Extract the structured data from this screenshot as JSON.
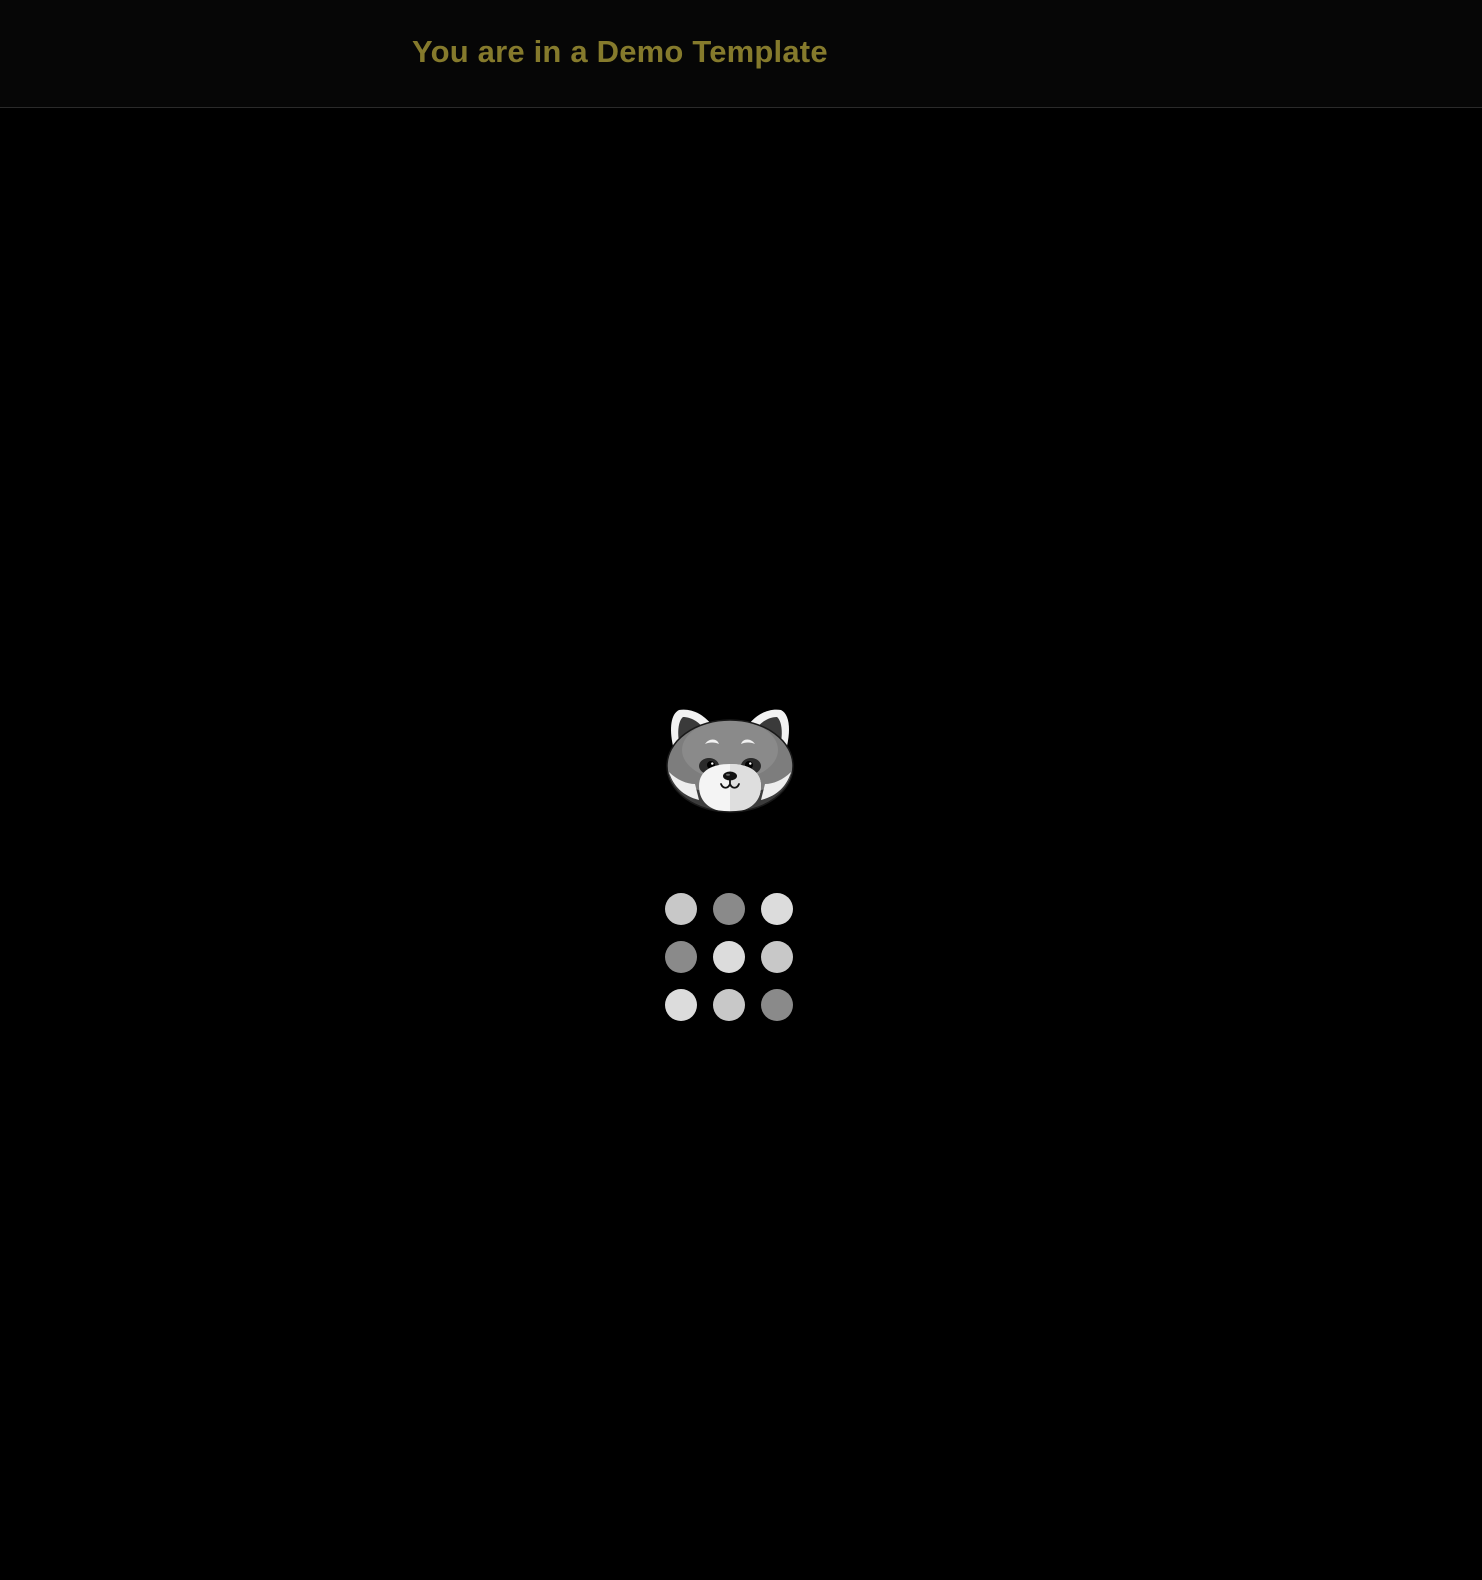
{
  "header": {
    "title": "You are in a Demo Template",
    "title_color": "#857a2c"
  },
  "loader": {
    "mascot_icon": "red-panda-mascot-icon",
    "spinner_icon": "loading-dots-grid-icon",
    "dot_colors": [
      "#c8c8c8",
      "#8a8a8a",
      "#dcdcdc",
      "#8a8a8a",
      "#dcdcdc",
      "#c8c8c8",
      "#dcdcdc",
      "#c8c8c8",
      "#8a8a8a"
    ]
  }
}
